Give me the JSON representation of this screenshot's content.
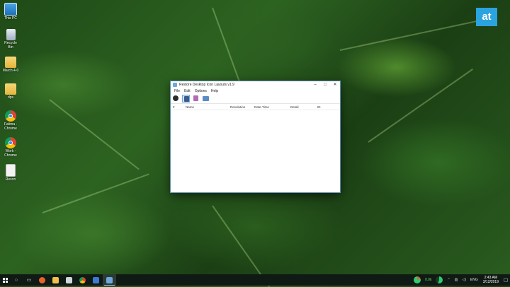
{
  "desktop": {
    "icons": [
      {
        "label": "This PC"
      },
      {
        "label": "Recycle Bin"
      },
      {
        "label": "March 4-0"
      },
      {
        "label": "dps"
      },
      {
        "label": "Fatima - Chrome"
      },
      {
        "label": "Work - Chrome"
      },
      {
        "label": "Reson"
      }
    ]
  },
  "brand_badge": "at",
  "window": {
    "title": "Restore Desktop Icon Layouts v1.9",
    "controls": {
      "minimize": "–",
      "maximize": "□",
      "close": "✕"
    },
    "menu": [
      "File",
      "Edit",
      "Options",
      "Help"
    ],
    "toolbar_icons": [
      "restore-layout-icon",
      "save-layout-icon",
      "delete-layout-icon",
      "properties-icon"
    ],
    "columns": [
      "#",
      "Name",
      "Resolution",
      "Date-Time",
      "Detail",
      "ID"
    ]
  },
  "taskbar": {
    "apps": [
      "firefox",
      "file-explorer",
      "mail",
      "chrome",
      "store",
      "restore-desktop-icon-layouts"
    ],
    "tray": {
      "net_label": "0.0k",
      "lang": "ENG",
      "time": "2:43 AM",
      "date": "3/12/2019"
    }
  },
  "colors": {
    "badge": "#2ba3df",
    "taskbar": "#101a14",
    "window_border": "#5f8fb4"
  }
}
